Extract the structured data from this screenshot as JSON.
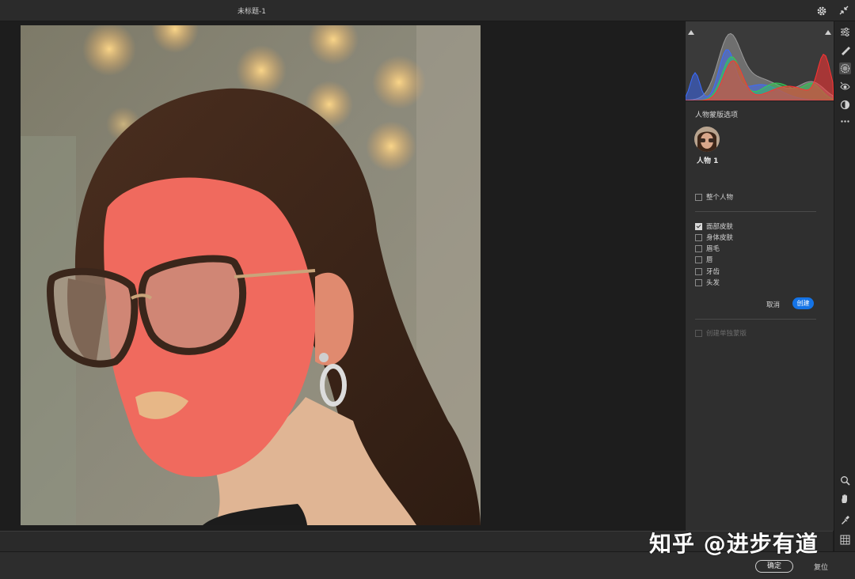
{
  "window": {
    "title": "未标题-1"
  },
  "histogram": {
    "channels": [
      "red",
      "green",
      "blue",
      "luminance"
    ],
    "colors": {
      "red": "#ff3333",
      "green": "#33cc55",
      "blue": "#3b6cff",
      "luminance": "#9a9a9a"
    }
  },
  "panel": {
    "title": "人物蒙版选项",
    "person": {
      "label": "人物 1"
    },
    "whole_person": {
      "label": "整个人物",
      "checked": false
    },
    "parts": [
      {
        "label": "面部皮肤",
        "checked": true
      },
      {
        "label": "身体皮肤",
        "checked": false
      },
      {
        "label": "眉毛",
        "checked": false
      },
      {
        "label": "唇",
        "checked": false
      },
      {
        "label": "牙齿",
        "checked": false
      },
      {
        "label": "头发",
        "checked": false
      }
    ],
    "cancel_label": "取消",
    "create_label": "创建",
    "separate_masks_label": "创建单独蒙版"
  },
  "footer": {
    "ok_label": "确定",
    "reset_label": "复位"
  },
  "toolbar": {
    "tools": [
      "edit-sliders-icon",
      "healing-brush-icon",
      "mask-icon",
      "red-eye-icon",
      "presets-icon",
      "more-icon",
      "zoom-icon",
      "hand-icon",
      "sampler-icon",
      "grid-icon"
    ],
    "active": "mask-icon"
  },
  "overlay_color": "#f06a5e",
  "accent_color": "#1473e6",
  "watermark": {
    "text": "知乎 @进步有道"
  }
}
